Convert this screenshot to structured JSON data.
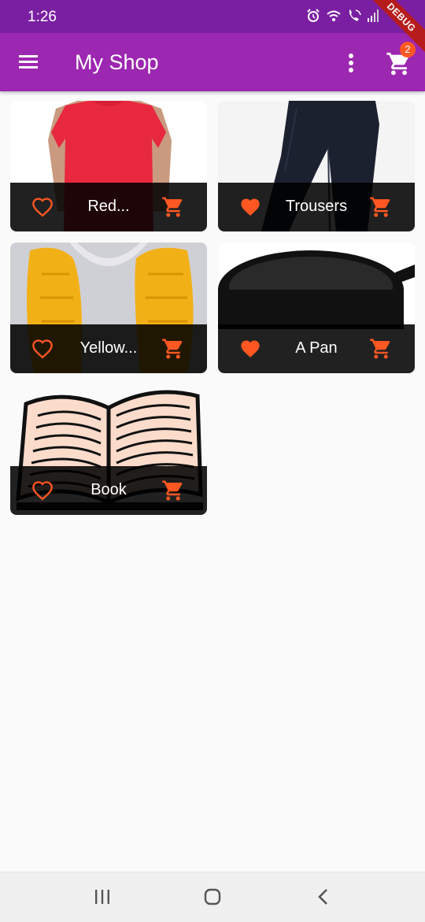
{
  "status_bar": {
    "time": "1:26",
    "icons": [
      "alarm-icon",
      "wifi-icon",
      "wifi-call-icon",
      "signal-icon"
    ]
  },
  "app_bar": {
    "title": "My Shop",
    "cart_badge_count": "2",
    "debug_label": "DEBUG"
  },
  "products": [
    {
      "title": "Red...",
      "favorite": false
    },
    {
      "title": "Trousers",
      "favorite": true
    },
    {
      "title": "Yellow...",
      "favorite": false
    },
    {
      "title": "A Pan",
      "favorite": true
    },
    {
      "title": "Book",
      "favorite": false
    }
  ],
  "colors": {
    "status_bar": "#7b1fa2",
    "app_bar": "#9c27b0",
    "accent": "#ff5722",
    "tile_footer": "#1e1e1e",
    "background": "#fafafa"
  },
  "nav_bar": {
    "buttons": [
      "recents-icon",
      "home-icon",
      "back-icon"
    ]
  }
}
